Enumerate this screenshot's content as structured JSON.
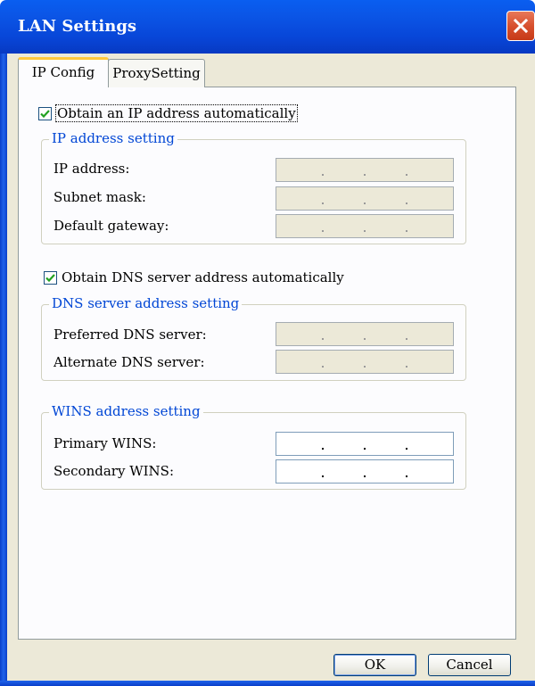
{
  "window": {
    "title": "LAN Settings"
  },
  "tabs": [
    {
      "label": "IP Config",
      "active": true
    },
    {
      "label": "ProxySetting",
      "active": false
    }
  ],
  "ip": {
    "auto_label": "Obtain an IP address automatically",
    "auto_checked": true,
    "group_label": "IP address setting",
    "fields": [
      {
        "label": "IP address:",
        "enabled": false
      },
      {
        "label": "Subnet mask:",
        "enabled": false
      },
      {
        "label": "Default gateway:",
        "enabled": false
      }
    ]
  },
  "dns": {
    "auto_label": "Obtain DNS server address automatically",
    "auto_checked": true,
    "group_label": "DNS server address setting",
    "fields": [
      {
        "label": "Preferred DNS server:",
        "enabled": false
      },
      {
        "label": "Alternate DNS server:",
        "enabled": false
      }
    ]
  },
  "wins": {
    "group_label": "WINS address setting",
    "fields": [
      {
        "label": "Primary WINS:",
        "enabled": true
      },
      {
        "label": "Secondary WINS:",
        "enabled": true
      }
    ]
  },
  "buttons": {
    "ok": "OK",
    "cancel": "Cancel"
  },
  "colors": {
    "titlebar": "#0846d8",
    "face": "#ece9d8",
    "legend": "#0046d5",
    "close": "#d8502e"
  },
  "icons": {
    "close": "close-icon",
    "check": "checkmark-icon"
  }
}
